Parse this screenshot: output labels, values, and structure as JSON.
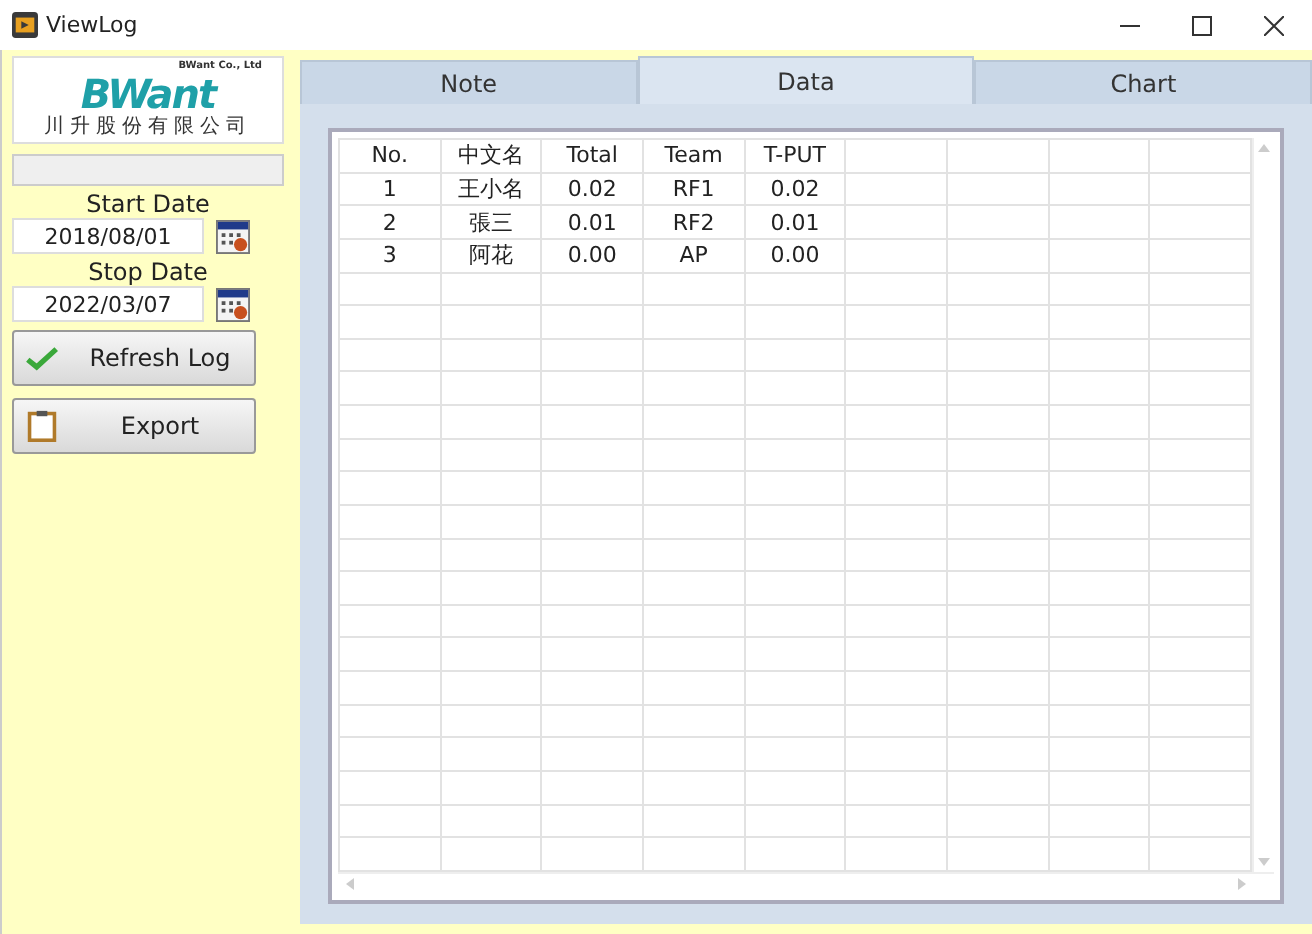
{
  "window": {
    "title": "ViewLog"
  },
  "logo": {
    "company": "BWant Co., Ltd",
    "brand": "BWant",
    "chinese_name": "川升股份有限公司"
  },
  "sidebar": {
    "start_date": {
      "label": "Start Date",
      "value": "2018/08/01"
    },
    "stop_date": {
      "label": "Stop Date",
      "value": "2022/03/07"
    },
    "buttons": [
      {
        "label": "Refresh Log",
        "kind": "refresh"
      },
      {
        "label": "Export",
        "kind": "export"
      }
    ]
  },
  "tabs": [
    {
      "label": "Note",
      "selected": false
    },
    {
      "label": "Data",
      "selected": true
    },
    {
      "label": "Chart",
      "selected": false
    }
  ],
  "table": {
    "columns": [
      "No.",
      "中文名",
      "Total",
      "Team",
      "T-PUT"
    ],
    "rows": [
      [
        "1",
        "王小名",
        "0.02",
        "RF1",
        "0.02"
      ],
      [
        "2",
        "張三",
        "0.01",
        "RF2",
        "0.01"
      ],
      [
        "3",
        "阿花",
        "0.00",
        "AP",
        "0.00"
      ]
    ]
  }
}
